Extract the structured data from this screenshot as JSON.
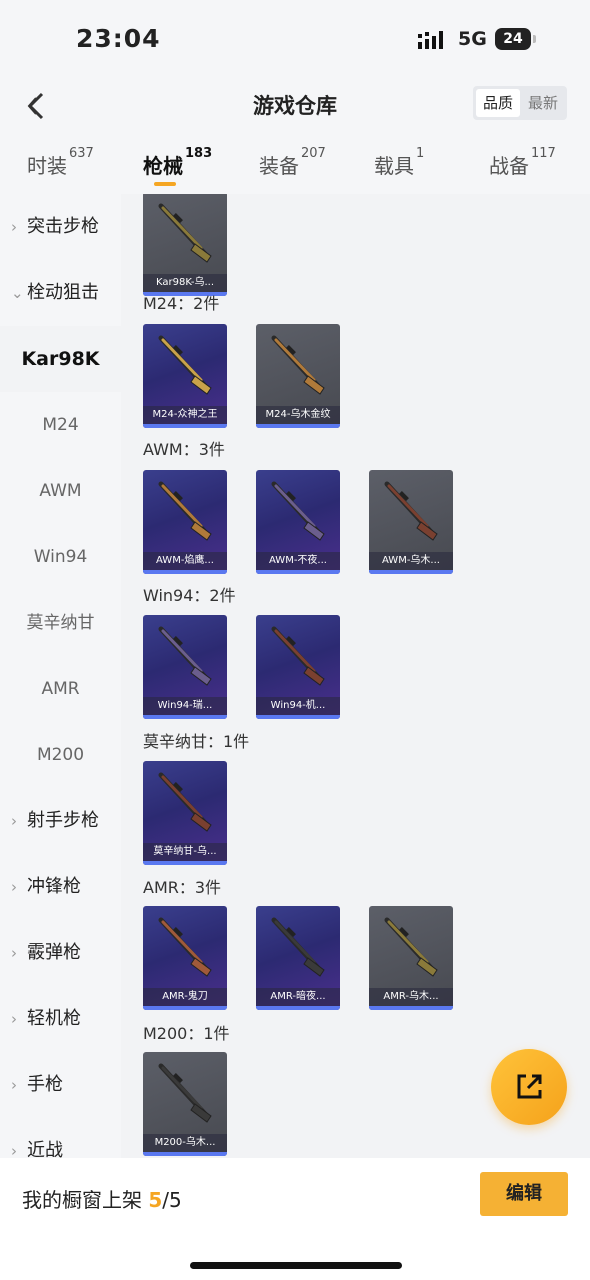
{
  "status": {
    "time": "23:04",
    "network": "5G",
    "battery": "24"
  },
  "header": {
    "title": "游戏仓库",
    "sort_quality": "品质",
    "sort_latest": "最新"
  },
  "tabs": [
    {
      "label": "时装",
      "count": "637"
    },
    {
      "label": "枪械",
      "count": "183"
    },
    {
      "label": "装备",
      "count": "207"
    },
    {
      "label": "载具",
      "count": "1"
    },
    {
      "label": "战备",
      "count": "117"
    }
  ],
  "sidebar": [
    {
      "label": "突击步枪",
      "type": "group"
    },
    {
      "label": "栓动狙击",
      "type": "group-open"
    },
    {
      "label": "Kar98K",
      "type": "active"
    },
    {
      "label": "M24",
      "type": "sub"
    },
    {
      "label": "AWM",
      "type": "sub"
    },
    {
      "label": "Win94",
      "type": "sub"
    },
    {
      "label": "莫辛纳甘",
      "type": "sub"
    },
    {
      "label": "AMR",
      "type": "sub"
    },
    {
      "label": "M200",
      "type": "sub"
    },
    {
      "label": "射手步枪",
      "type": "group"
    },
    {
      "label": "冲锋枪",
      "type": "group"
    },
    {
      "label": "霰弹枪",
      "type": "group"
    },
    {
      "label": "轻机枪",
      "type": "group"
    },
    {
      "label": "手枪",
      "type": "group"
    },
    {
      "label": "近战",
      "type": "group"
    }
  ],
  "sections": [
    {
      "label": "",
      "items": [
        {
          "name": "Kar98K-乌...",
          "style": "gray"
        }
      ]
    },
    {
      "label": "M24：2件",
      "items": [
        {
          "name": "M24-众神之王",
          "style": "purple"
        },
        {
          "name": "M24-乌木金纹",
          "style": "gray"
        }
      ]
    },
    {
      "label": "AWM：3件",
      "items": [
        {
          "name": "AWM-焰鹰...",
          "style": "purple"
        },
        {
          "name": "AWM-不夜...",
          "style": "purple"
        },
        {
          "name": "AWM-乌木...",
          "style": "gray"
        }
      ]
    },
    {
      "label": "Win94：2件",
      "items": [
        {
          "name": "Win94-瑞...",
          "style": "purple"
        },
        {
          "name": "Win94-机...",
          "style": "purple"
        }
      ]
    },
    {
      "label": "莫辛纳甘：1件",
      "items": [
        {
          "name": "莫辛纳甘-乌...",
          "style": "purple"
        }
      ]
    },
    {
      "label": "AMR：3件",
      "items": [
        {
          "name": "AMR-鬼刀",
          "style": "purple"
        },
        {
          "name": "AMR-暗夜...",
          "style": "purple"
        },
        {
          "name": "AMR-乌木...",
          "style": "gray"
        }
      ]
    },
    {
      "label": "M200：1件",
      "items": [
        {
          "name": "M200-乌木...",
          "style": "gray"
        }
      ]
    }
  ],
  "bottom": {
    "shelf_prefix": "我的橱窗上架 ",
    "shelf_count": "5",
    "shelf_total": "/5",
    "edit_label": "编辑"
  },
  "colors": {
    "accent": "#f5a623",
    "purple_card": "#2c2a72",
    "gray_card": "#4f5158",
    "rarity_bar": "#5a78f0"
  },
  "icons": {
    "back": "chevron-left-icon",
    "share": "share-icon"
  }
}
